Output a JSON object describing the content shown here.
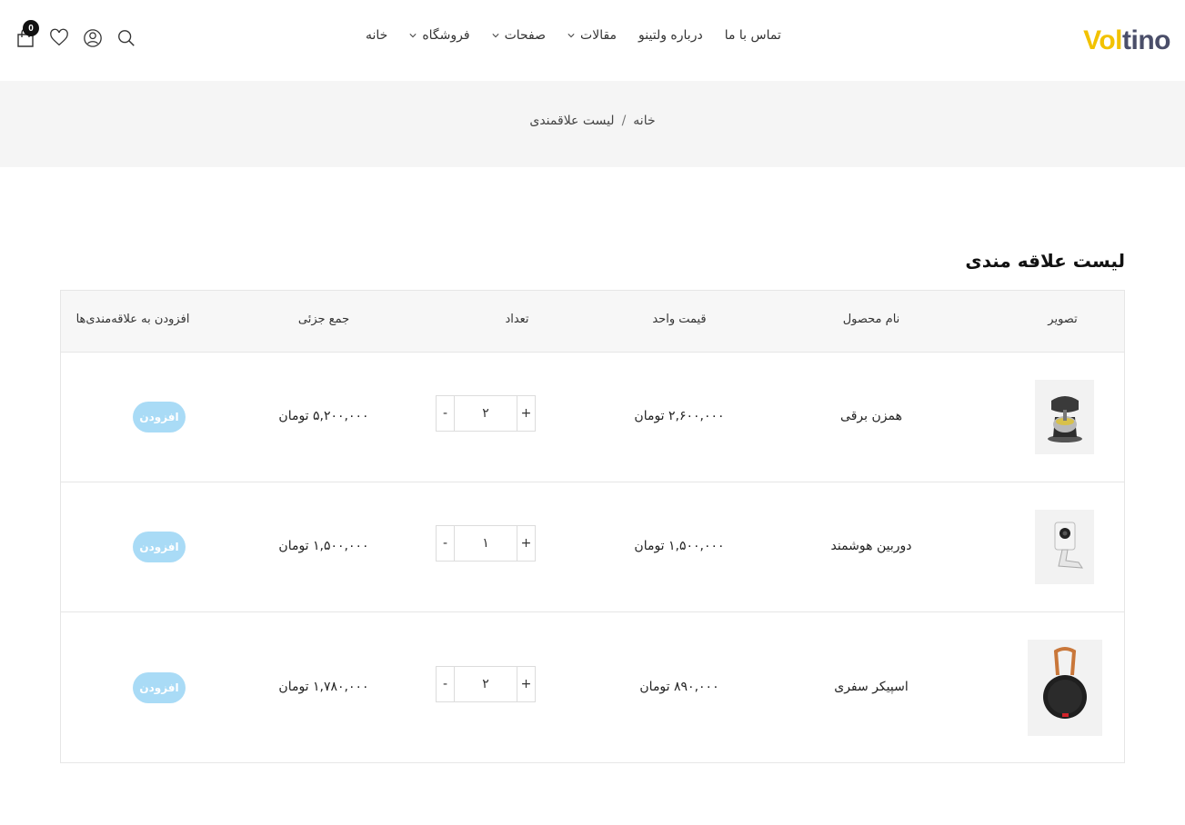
{
  "brand": {
    "logo_part1": "Vol",
    "logo_part2": "tino"
  },
  "nav": {
    "items": [
      {
        "label": "خانه",
        "has_dropdown": false
      },
      {
        "label": "فروشگاه",
        "has_dropdown": true
      },
      {
        "label": "صفحات",
        "has_dropdown": true
      },
      {
        "label": "مقالات",
        "has_dropdown": true
      },
      {
        "label": "درباره ولتینو",
        "has_dropdown": false
      },
      {
        "label": "تماس با ما",
        "has_dropdown": false
      }
    ]
  },
  "header_icons": {
    "cart_count": "0"
  },
  "breadcrumb": {
    "home": "خانه",
    "separator": "/",
    "current": "لیست علاقمندی"
  },
  "page": {
    "title": "لیست علاقه مندی"
  },
  "table": {
    "headers": {
      "image": "تصویر",
      "product_name": "نام محصول",
      "unit_price": "قیمت واحد",
      "quantity": "تعداد",
      "subtotal": "جمع جزئی",
      "add_to_wishlist": "افزودن به علاقه‌مندی‌ها"
    },
    "rows": [
      {
        "name": "همزن برقی",
        "unit_price": "۲,۶۰۰,۰۰۰ تومان",
        "quantity": "۲",
        "subtotal": "۵,۲۰۰,۰۰۰ تومان",
        "add_label": "افزودن",
        "minus": "-",
        "plus": "+"
      },
      {
        "name": "دوربین هوشمند",
        "unit_price": "۱,۵۰۰,۰۰۰ تومان",
        "quantity": "۱",
        "subtotal": "۱,۵۰۰,۰۰۰ تومان",
        "add_label": "افزودن",
        "minus": "-",
        "plus": "+"
      },
      {
        "name": "اسپیکر سفری",
        "unit_price": "۸۹۰,۰۰۰ تومان",
        "quantity": "۲",
        "subtotal": "۱,۷۸۰,۰۰۰ تومان",
        "add_label": "افزودن",
        "minus": "-",
        "plus": "+"
      }
    ]
  },
  "colors": {
    "logo_yellow": "#f2c200",
    "logo_dark": "#4a4e69",
    "add_button": "#a9dbf6",
    "band": "#f5f5f5"
  }
}
